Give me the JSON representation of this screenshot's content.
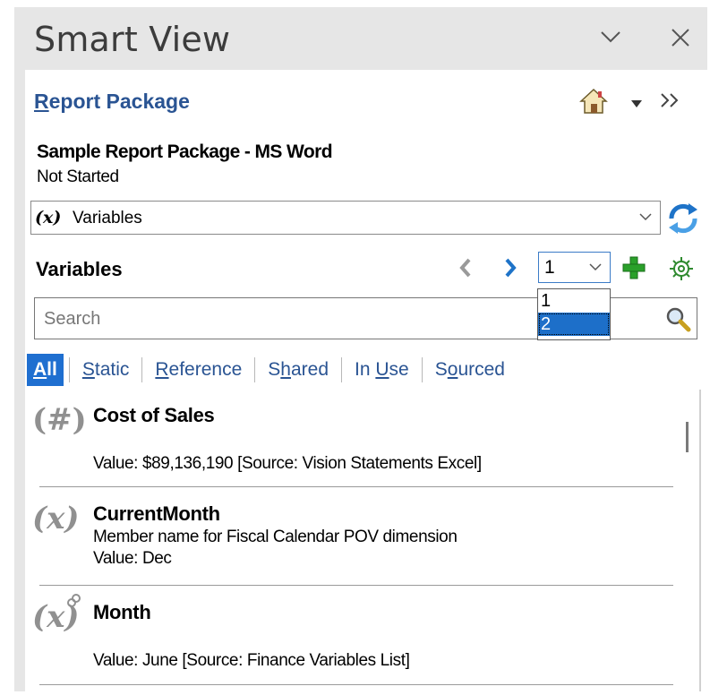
{
  "panel": {
    "title": "Smart View",
    "collapse_icon": "chevron-down-icon",
    "close_icon": "close-icon"
  },
  "report_package": {
    "link_first": "R",
    "link_rest": "eport Package",
    "home_icon": "home-icon",
    "menu_icon": "caret-down-icon",
    "expand_icon": "double-chevron-right-icon"
  },
  "package": {
    "name": "Sample Report Package - MS Word",
    "status": "Not Started"
  },
  "view_combo": {
    "prefix": "(x)",
    "value": "Variables",
    "refresh_icon": "refresh-icon"
  },
  "variables": {
    "title": "Variables",
    "page_value": "1",
    "page_options": [
      "1",
      "2"
    ],
    "page_selected_index": 1,
    "search_placeholder": "Search"
  },
  "filters": [
    {
      "pre": "",
      "u": "A",
      "post": "ll",
      "active": true
    },
    {
      "pre": "",
      "u": "S",
      "post": "tatic",
      "active": false
    },
    {
      "pre": "",
      "u": "R",
      "post": "eference",
      "active": false
    },
    {
      "pre": "S",
      "u": "h",
      "post": "ared",
      "active": false
    },
    {
      "pre": "In ",
      "u": "U",
      "post": "se",
      "active": false
    },
    {
      "pre": "S",
      "u": "o",
      "post": "urced",
      "active": false
    }
  ],
  "items": [
    {
      "icon": "(#)",
      "name": "Cost of Sales",
      "lines": [
        "",
        "Value:  $89,136,190  [Source: Vision Statements Excel]"
      ]
    },
    {
      "icon": "(x)",
      "name": "CurrentMonth",
      "lines": [
        "Member name for Fiscal Calendar POV dimension",
        "Value: Dec"
      ]
    },
    {
      "icon": "(x)",
      "name": "Month",
      "lines": [
        "",
        "Value: June [Source: Finance Variables List]"
      ]
    }
  ],
  "colors": {
    "header_bg": "#e6e6e6",
    "link": "#2a5493",
    "accent": "#1f6fd0",
    "icon_gray": "#909090"
  }
}
